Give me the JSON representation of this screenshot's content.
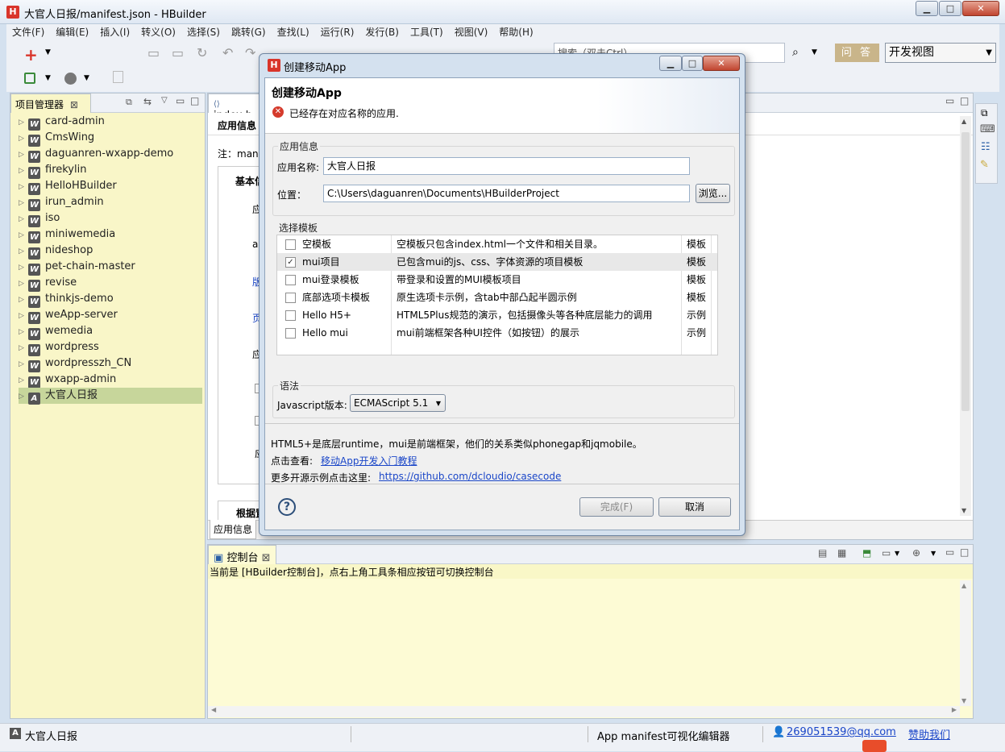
{
  "window": {
    "title": "大官人日报/manifest.json  -  HBuilder",
    "logo": "H",
    "min": "▁",
    "max": "□",
    "close": "✕"
  },
  "menu": [
    "文件(F)",
    "编辑(E)",
    "插入(I)",
    "转义(O)",
    "选择(S)",
    "跳转(G)",
    "查找(L)",
    "运行(R)",
    "发行(B)",
    "工具(T)",
    "视图(V)",
    "帮助(H)"
  ],
  "toolbar": {
    "search_placeholder": "搜索（双击Ctrl）",
    "qa_label": "问 答",
    "view_select": "开发视图"
  },
  "project_panel": {
    "tab_label": "项目管理器",
    "items": [
      "card-admin",
      "CmsWing",
      "daguanren-wxapp-demo",
      "firekylin",
      "HelloHBuilder",
      "irun_admin",
      "iso",
      "miniwemedia",
      "nideshop",
      "pet-chain-master",
      "revise",
      "thinkjs-demo",
      "weApp-server",
      "wemedia",
      "wordpress",
      "wordpresszh_CN",
      "wxapp-admin",
      "大官人日报"
    ]
  },
  "editor": {
    "tab_label": "index.h",
    "header": "应用信息",
    "note": "注：mani",
    "basic": "基本信",
    "row1": "应",
    "row2": "ap",
    "row3": "版",
    "row4": "页",
    "row5": "应",
    "row6": "应",
    "bottom_sub": "根据置",
    "bottom_tab": "应用信息"
  },
  "console": {
    "tab_label": "控制台",
    "message": "当前是 [HBuilder控制台]，点右上角工具条相应按钮可切换控制台"
  },
  "status": {
    "project": "大官人日报",
    "editor_name": "App manifest可视化编辑器",
    "email": "269051539@qq.com",
    "sponsor": "赞助我们"
  },
  "dialog": {
    "title": "创建移动App",
    "heading": "创建移动App",
    "error": "已经存在对应名称的应用.",
    "app_info_group": "应用信息",
    "app_name_label": "应用名称:",
    "app_name_value": "大官人日报",
    "location_label": "位置：",
    "location_value": "C:\\Users\\daguanren\\Documents\\HBuilderProject",
    "browse_label": "浏览...",
    "template_group": "选择模板",
    "templates": [
      {
        "name": "空模板",
        "desc": "空模板只包含index.html一个文件和相关目录。",
        "type": "模板",
        "checked": ""
      },
      {
        "name": "mui项目",
        "desc": "已包含mui的js、css、字体资源的项目模板",
        "type": "模板",
        "checked": "✓"
      },
      {
        "name": "mui登录模板",
        "desc": "带登录和设置的MUI模板项目",
        "type": "模板",
        "checked": ""
      },
      {
        "name": "底部选项卡模板",
        "desc": "原生选项卡示例，含tab中部凸起半圆示例",
        "type": "模板",
        "checked": ""
      },
      {
        "name": "Hello H5+",
        "desc": "HTML5Plus规范的演示，包括摄像头等各种底层能力的调用",
        "type": "示例",
        "checked": ""
      },
      {
        "name": "Hello mui",
        "desc": "mui前端框架各种UI控件（如按钮）的展示",
        "type": "示例",
        "checked": ""
      }
    ],
    "syntax_group": "语法",
    "js_version_label": "Javascript版本:",
    "js_version_value": "ECMAScript 5.1",
    "info_line1": "HTML5+是底层runtime，mui是前端框架，他们的关系类似phonegap和jqmobile。",
    "info_line2_prefix": "点击查看:",
    "info_line2_link": "移动App开发入门教程",
    "info_line3_prefix": "更多开源示例点击这里:",
    "info_line3_link": "https://github.com/dcloudio/casecode",
    "finish_label": "完成(F)",
    "cancel_label": "取消",
    "help_glyph": "?"
  }
}
